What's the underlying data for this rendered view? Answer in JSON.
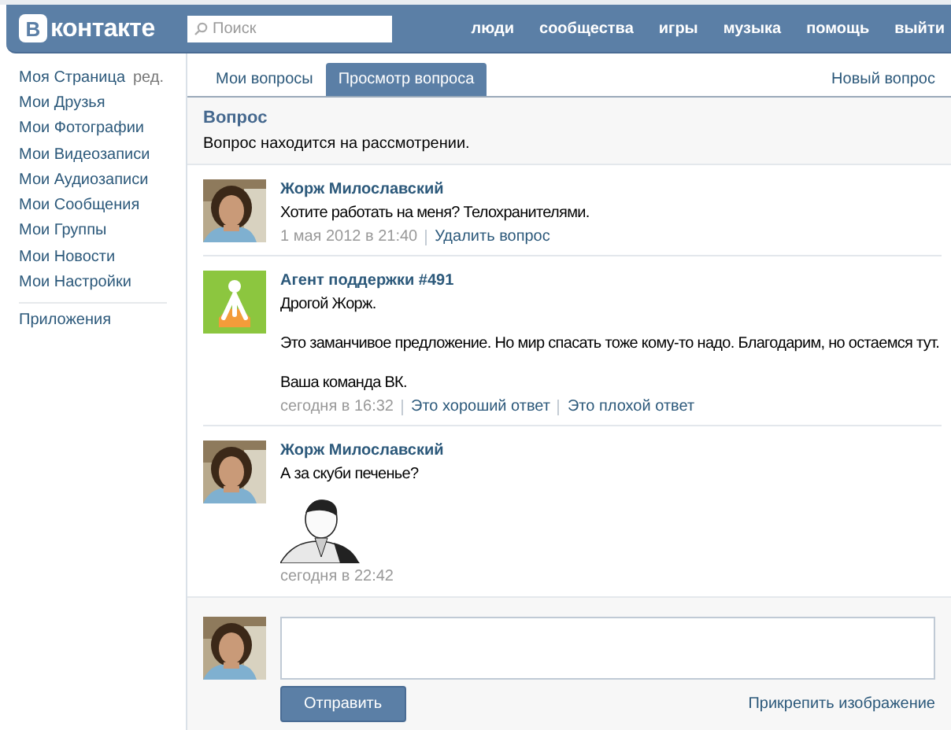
{
  "header": {
    "logo_mark": "В",
    "logo_text": "контакте",
    "search": {
      "placeholder": "Поиск"
    },
    "nav": [
      "люди",
      "сообщества",
      "игры",
      "музыка",
      "помощь",
      "выйти"
    ]
  },
  "sidebar": {
    "items": [
      {
        "label": "Моя Страница",
        "edit": "ред."
      },
      {
        "label": "Мои Друзья"
      },
      {
        "label": "Мои Фотографии"
      },
      {
        "label": "Мои Видеозаписи"
      },
      {
        "label": "Мои Аудиозаписи"
      },
      {
        "label": "Мои Сообщения"
      },
      {
        "label": "Мои Группы"
      },
      {
        "label": "Мои Новости"
      },
      {
        "label": "Мои Настройки"
      }
    ],
    "extra": [
      "Приложения"
    ]
  },
  "tabs": [
    {
      "label": "Мои вопросы",
      "selected": false
    },
    {
      "label": "Просмотр вопроса",
      "selected": true
    }
  ],
  "new_question": "Новый вопрос",
  "question": {
    "title": "Вопрос",
    "status": "Вопрос находится на рассмотрении."
  },
  "messages": [
    {
      "avatar": {
        "kind": "picture"
      },
      "author": "Жорж Милославский",
      "paragraphs": [
        "Хотите работать на меня? Телохранителями."
      ],
      "time": "1 мая 2012 в 21:40",
      "actions": [
        "Удалить вопрос"
      ]
    },
    {
      "avatar": {
        "kind": "support"
      },
      "author": "Агент поддержки #491",
      "paragraphs": [
        "Дрогой Жорж.",
        "Это заманчивое предложение. Но мир спасать тоже кому-то надо. Благодарим, но остаемся тут.",
        "Ваша команда ВК."
      ],
      "time": "сегодня в 16:32",
      "actions": [
        "Это хороший ответ",
        "Это плохой ответ"
      ]
    },
    {
      "avatar": {
        "kind": "picture"
      },
      "author": "Жорж Милославский",
      "paragraphs": [
        "А за скуби печенье?"
      ],
      "attachment": {
        "kind": "picture"
      },
      "time": "сегодня в 22:42"
    }
  ],
  "reply": {
    "avatar": {
      "kind": "picture"
    },
    "button": "Отправить",
    "attach": "Прикрепить изображение"
  }
}
